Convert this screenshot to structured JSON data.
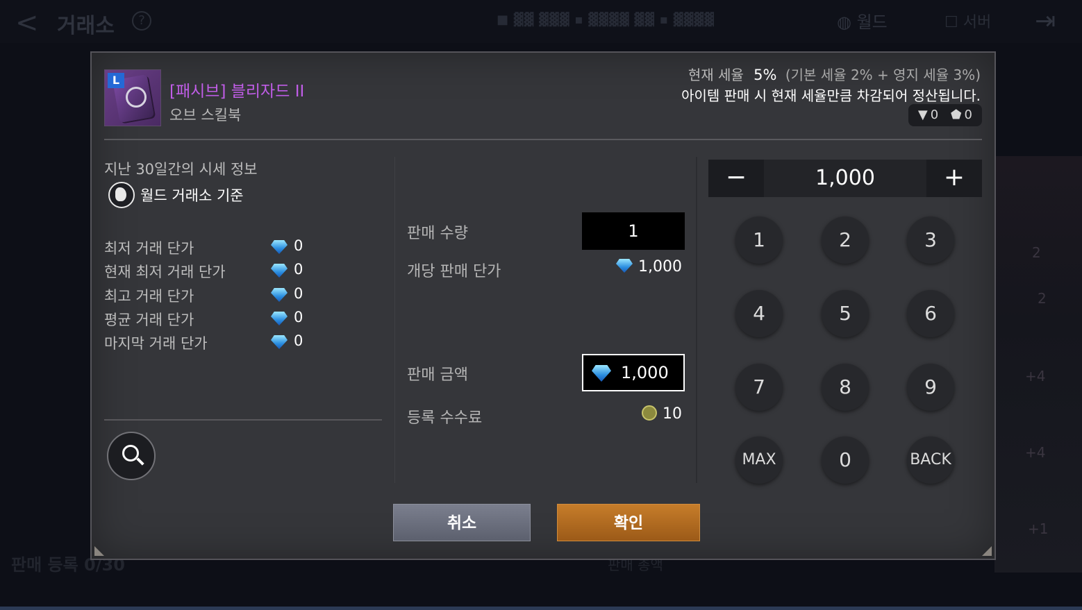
{
  "background": {
    "title": "거래소",
    "world_label": "월드",
    "server_label": "서버",
    "top_items": "■ ▓▓ ▓▓▓ ▪ ▓▓▓▓ ▓▓ ▪ ▓▓▓▓",
    "bottom_left": "판매 등록 0/30",
    "bottom_mid": "판매 총액",
    "side_numbers": [
      "2",
      "2",
      "+4",
      "+4",
      "+1"
    ]
  },
  "item": {
    "grade": "L",
    "name": "[패시브] 블리자드 II",
    "type": "오브 스킬북"
  },
  "tax": {
    "label": "현재 세율",
    "value": "5%",
    "detail": "(기본 세율 2% + 영지 세율 3%)",
    "notice": "아이템 판매 시 현재 세율만큼 차감되어 정산됩니다.",
    "counter_a": "0",
    "counter_b": "0"
  },
  "market": {
    "title": "지난 30일간의 시세 정보",
    "subtitle": "월드 거래소 기준",
    "rows": [
      {
        "label": "최저 거래 단가",
        "value": "0"
      },
      {
        "label": "현재 최저 거래 단가",
        "value": "0"
      },
      {
        "label": "최고 거래 단가",
        "value": "0"
      },
      {
        "label": "평균 거래 단가",
        "value": "0"
      },
      {
        "label": "마지막 거래 단가",
        "value": "0"
      }
    ]
  },
  "sale": {
    "quantity_label": "판매 수량",
    "quantity_value": "1",
    "unit_price_label": "개당 판매 단가",
    "unit_price_value": "1,000",
    "total_label": "판매 금액",
    "total_value": "1,000",
    "fee_label": "등록 수수료",
    "fee_value": "10"
  },
  "pad": {
    "minus": "−",
    "plus": "+",
    "value": "1,000",
    "keys": [
      "1",
      "2",
      "3",
      "4",
      "5",
      "6",
      "7",
      "8",
      "9",
      "MAX",
      "0",
      "BACK"
    ]
  },
  "buttons": {
    "cancel": "취소",
    "confirm": "확인"
  }
}
